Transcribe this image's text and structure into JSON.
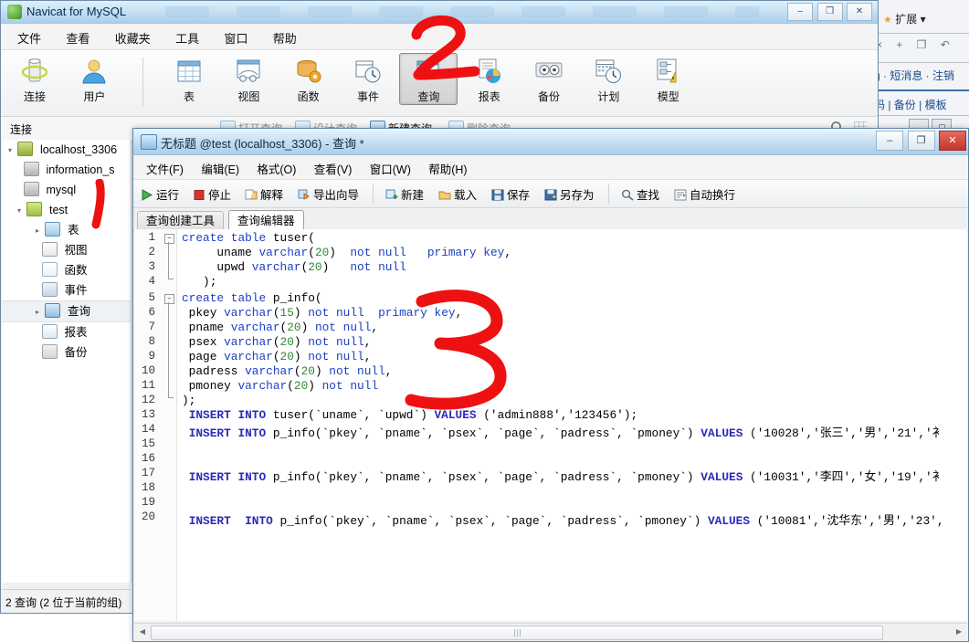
{
  "main_window": {
    "title": "Navicat for MySQL",
    "app_icon": "navicat-icon",
    "window_buttons": {
      "minimize": "–",
      "maximize": "❐",
      "close": "✕"
    },
    "menubar": [
      "文件",
      "查看",
      "收藏夹",
      "工具",
      "窗口",
      "帮助"
    ],
    "toolbar_left": [
      {
        "label": "连接",
        "icon": "connection-icon"
      },
      {
        "label": "用户",
        "icon": "user-icon"
      }
    ],
    "toolbar_right": [
      {
        "label": "表",
        "icon": "table-icon"
      },
      {
        "label": "视图",
        "icon": "view-icon"
      },
      {
        "label": "函数",
        "icon": "function-icon"
      },
      {
        "label": "事件",
        "icon": "event-icon"
      },
      {
        "label": "查询",
        "icon": "query-icon",
        "selected": true
      },
      {
        "label": "报表",
        "icon": "report-icon"
      },
      {
        "label": "备份",
        "icon": "backup-icon"
      },
      {
        "label": "计划",
        "icon": "schedule-icon"
      },
      {
        "label": "模型",
        "icon": "model-icon"
      }
    ],
    "context_bar": {
      "label": "连接",
      "actions": [
        {
          "label": "打开查询",
          "enabled": false
        },
        {
          "label": "设计查询",
          "enabled": false
        },
        {
          "label": "新建查询",
          "enabled": true
        },
        {
          "label": "删除查询",
          "enabled": false
        }
      ],
      "search_icon": "search-icon",
      "grid_icon": "grid-view-icon"
    },
    "status_bar": "2 查询 (2 位于当前的组)"
  },
  "tree": [
    {
      "label": "localhost_3306",
      "depth": 0,
      "arrow": "▾",
      "icon": "server-icon"
    },
    {
      "label": "information_s",
      "depth": 1,
      "arrow": "",
      "icon": "database-gray-icon"
    },
    {
      "label": "mysql",
      "depth": 1,
      "arrow": "",
      "icon": "database-gray-icon"
    },
    {
      "label": "test",
      "depth": 1,
      "arrow": "▾",
      "icon": "database-open-icon"
    },
    {
      "label": "表",
      "depth": 2,
      "arrow": "▸",
      "icon": "table-icon"
    },
    {
      "label": "视图",
      "depth": 2,
      "arrow": "",
      "icon": "view-icon"
    },
    {
      "label": "函数",
      "depth": 2,
      "arrow": "",
      "icon": "function-icon"
    },
    {
      "label": "事件",
      "depth": 2,
      "arrow": "",
      "icon": "event-icon"
    },
    {
      "label": "查询",
      "depth": 2,
      "arrow": "▸",
      "icon": "query-icon",
      "selected": true
    },
    {
      "label": "报表",
      "depth": 2,
      "arrow": "",
      "icon": "report-icon"
    },
    {
      "label": "备份",
      "depth": 2,
      "arrow": "",
      "icon": "backup-icon"
    }
  ],
  "query_window": {
    "title": "无标题 @test (localhost_3306) - 查询 *",
    "title_icon": "query-window-icon",
    "window_buttons": {
      "minimize": "–",
      "maximize": "❐",
      "close": "✕"
    },
    "menubar": [
      "文件(F)",
      "编辑(E)",
      "格式(O)",
      "查看(V)",
      "窗口(W)",
      "帮助(H)"
    ],
    "toolbar": [
      {
        "label": "运行",
        "icon": "run-icon"
      },
      {
        "label": "停止",
        "icon": "stop-icon"
      },
      {
        "label": "解释",
        "icon": "explain-icon"
      },
      {
        "label": "导出向导",
        "icon": "export-wizard-icon"
      },
      {
        "label": "新建",
        "icon": "new-icon"
      },
      {
        "label": "载入",
        "icon": "load-icon"
      },
      {
        "label": "保存",
        "icon": "save-icon"
      },
      {
        "label": "另存为",
        "icon": "save-as-icon"
      },
      {
        "label": "查找",
        "icon": "search-icon"
      },
      {
        "label": "自动换行",
        "icon": "word-wrap-icon"
      }
    ],
    "tabs": [
      {
        "label": "查询创建工具",
        "active": false
      },
      {
        "label": "查询编辑器",
        "active": true
      }
    ]
  },
  "editor": {
    "line_count": 20,
    "lines": [
      {
        "n": 1,
        "fold": "open",
        "text": "create table tuser("
      },
      {
        "n": 2,
        "text": "     uname varchar(20)  not null   primary key,"
      },
      {
        "n": 3,
        "text": "     upwd varchar(20)   not null"
      },
      {
        "n": 4,
        "fold": "end",
        "text": "   );"
      },
      {
        "n": 5,
        "fold": "open",
        "text": "create table p_info("
      },
      {
        "n": 6,
        "text": " pkey varchar(15) not null  primary key,"
      },
      {
        "n": 7,
        "text": " pname varchar(20) not null,"
      },
      {
        "n": 8,
        "text": " psex varchar(20) not null,"
      },
      {
        "n": 9,
        "text": " page varchar(20) not null,"
      },
      {
        "n": 10,
        "text": " padress varchar(20) not null,"
      },
      {
        "n": 11,
        "text": " pmoney varchar(20) not null"
      },
      {
        "n": 12,
        "fold": "end",
        "text": ");"
      },
      {
        "n": 13,
        "text": " INSERT INTO tuser(`uname`, `upwd`) VALUES ('admin888','123456');"
      },
      {
        "n": 14,
        "text": " INSERT INTO p_info(`pkey`, `pname`, `psex`, `page`, `padress`, `pmoney`) VALUES ('10028','张三','男','21','衤"
      },
      {
        "n": 15,
        "text": ""
      },
      {
        "n": 16,
        "text": ""
      },
      {
        "n": 17,
        "text": " INSERT INTO p_info(`pkey`, `pname`, `psex`, `page`, `padress`, `pmoney`) VALUES ('10031','李四','女','19','衤"
      },
      {
        "n": 18,
        "text": ""
      },
      {
        "n": 19,
        "text": ""
      },
      {
        "n": 20,
        "text": " INSERT  INTO p_info(`pkey`, `pname`, `psex`, `page`, `padress`, `pmoney`) VALUES ('10081','沈华东','男','23',"
      }
    ]
  },
  "annotations": [
    {
      "label": "1",
      "color": "#ee1111",
      "target": "tree-node-test"
    },
    {
      "label": "2",
      "color": "#ee1111",
      "target": "toolbar-query-button"
    },
    {
      "label": "3",
      "color": "#ee1111",
      "target": "sql-editor"
    }
  ],
  "background_window": {
    "extension_label": "扩展",
    "links_row1": "g · 短消息 · 注销",
    "links_row2": "码 | 备份 | 模板",
    "toolbar_icons": "×  +  ❐  ↶"
  }
}
